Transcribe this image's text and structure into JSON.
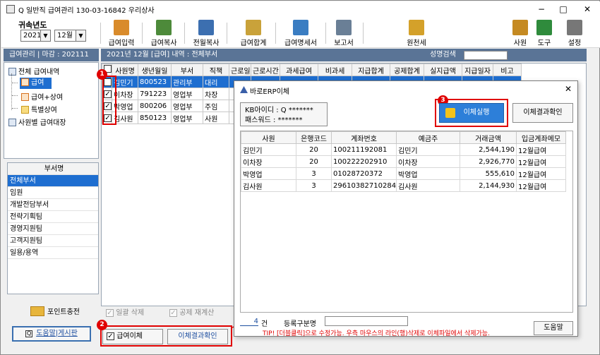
{
  "title": "Q 일반직 급여관리 130-03-16842 우리상사",
  "window_controls": [
    "−",
    "□",
    "✕"
  ],
  "belong": {
    "label": "귀속년도",
    "year": "2021",
    "month": "12월"
  },
  "toolbar": {
    "left": [
      {
        "label": "급여입력",
        "icon": "payroll-input-icon",
        "color": "#d98b2b"
      },
      {
        "label": "급여복사",
        "icon": "payroll-copy-icon",
        "color": "#4d8a3a"
      },
      {
        "label": "전월복사",
        "icon": "prev-month-copy-icon",
        "color": "#3c6fb0"
      },
      {
        "label": "급여합계",
        "icon": "payroll-total-icon",
        "color": "#c9a23a"
      },
      {
        "label": "급여명세서",
        "icon": "payslip-icon",
        "color": "#3a7dc2"
      },
      {
        "label": "보고서",
        "icon": "report-icon",
        "color": "#6a7f96"
      },
      {
        "label": "원천세",
        "icon": "withholding-tax-icon",
        "color": "#d4a12a"
      }
    ],
    "right": [
      {
        "label": "사원",
        "icon": "employee-icon",
        "color": "#c58a22"
      },
      {
        "label": "도구",
        "icon": "excel-tool-icon",
        "color": "#2f8b3c"
      },
      {
        "label": "설정",
        "icon": "settings-gear-icon",
        "color": "#777777"
      }
    ]
  },
  "left_header": "급여관리 | 마감 : 202111",
  "tree": [
    {
      "label": "전체 급여내역",
      "icon": "folder-icon"
    },
    {
      "label": "급여",
      "icon": "pay-doc-icon",
      "selected": true
    },
    {
      "label": "급여+상여",
      "icon": "pay-bonus-icon"
    },
    {
      "label": "특별상여",
      "icon": "special-bonus-icon"
    },
    {
      "label": "사원별 급여대장",
      "icon": "ledger-icon"
    }
  ],
  "dept": {
    "header": "부서명",
    "items": [
      "전체부서",
      "임원",
      "개발전담부서",
      "전략기획팀",
      "경영지원팀",
      "고객지원팀",
      "일용/용역"
    ],
    "selected": 0
  },
  "bottom_left": {
    "point_label": "포인트충전",
    "help_label": "도움말|게시판"
  },
  "main_header": {
    "text": "2021년 12월 [급여] 내역 : 전체부서",
    "search_label": "성명검색"
  },
  "grid": {
    "columns": [
      "",
      "사원명",
      "생년월일",
      "부서",
      "직책",
      "근로일",
      "근로시간",
      "과세급여",
      "비과세",
      "지급합계",
      "공제합계",
      "실지급액",
      "지급일자",
      "비고"
    ],
    "rows": [
      {
        "checked": true,
        "name": "김민기",
        "birth": "800523",
        "dept": "관리부",
        "pos": "대리",
        "selected": true
      },
      {
        "checked": true,
        "name": "이차장",
        "birth": "791223",
        "dept": "영업부",
        "pos": "차장"
      },
      {
        "checked": true,
        "name": "박영업",
        "birth": "800206",
        "dept": "영업부",
        "pos": "주임"
      },
      {
        "checked": true,
        "name": "김사원",
        "birth": "850123",
        "dept": "영업부",
        "pos": "사원"
      }
    ]
  },
  "bottom_checks": [
    "일괄 삭제",
    "공제 재계산"
  ],
  "bottom_buttons": {
    "transfer": "급여이체",
    "result": "이체결과확인"
  },
  "badges": [
    "1",
    "2",
    "3"
  ],
  "dialog": {
    "title": "바로ERP이체",
    "close": "✕",
    "id_label": "KB아이디 : Q *******",
    "pw_label": "패스워드 : *******",
    "run": "이체실행",
    "result": "이체결과확인",
    "columns": [
      "사원",
      "은행코드",
      "계좌번호",
      "예금주",
      "거래금액",
      "입금계좌메모"
    ],
    "rows": [
      [
        "김민기",
        "20",
        "100211192081",
        "김민기",
        "2,544,190",
        "12월급여"
      ],
      [
        "이차장",
        "20",
        "100222202910",
        "이차장",
        "2,926,770",
        "12월급여"
      ],
      [
        "박영업",
        "3",
        "01028720372",
        "박영업",
        "555,610",
        "12월급여"
      ],
      [
        "김사원",
        "3",
        "29610382710284",
        "김사원",
        "2,144,930",
        "12월급여"
      ]
    ],
    "count": "4",
    "count_unit": "건",
    "reg_label": "등록구분명",
    "tip": "TIP! [더블클릭]으로 수정가능. 우측 마우스의 라인(행)삭제로 이체파일에서 삭제가능.",
    "help": "도움말"
  },
  "colors": {
    "header": "#5a7496",
    "selected": "#1e6ed0",
    "highlight": "#e00000"
  }
}
